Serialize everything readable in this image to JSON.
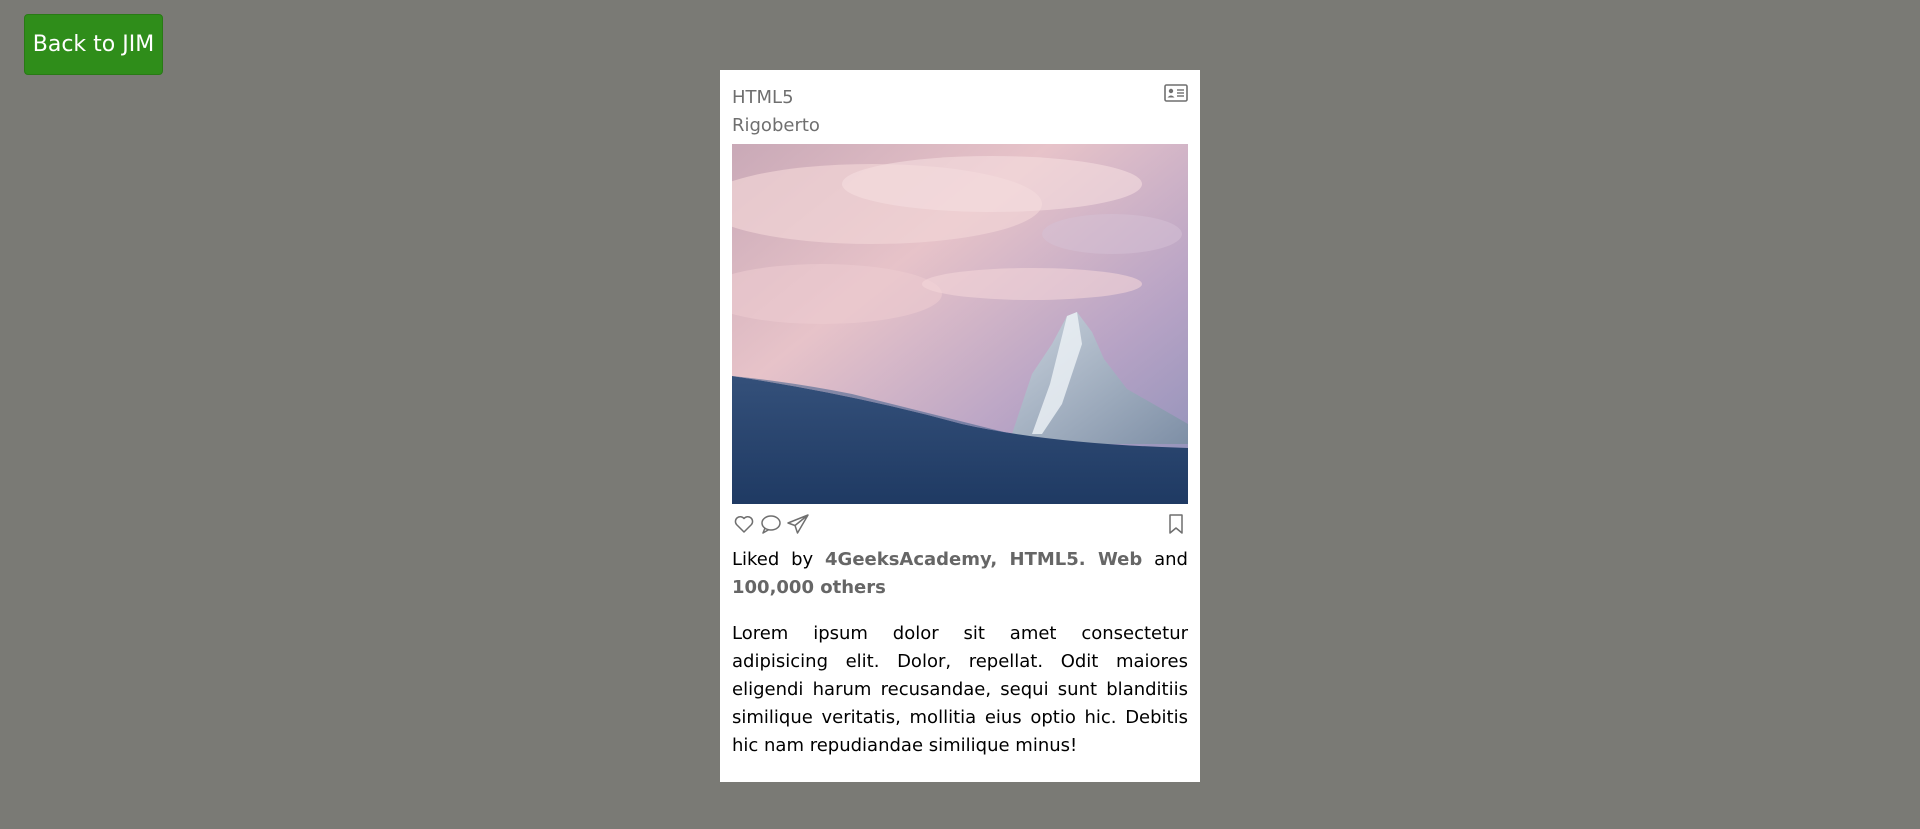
{
  "back_button": {
    "label": "Back to JIM"
  },
  "card": {
    "title": "HTML5",
    "user": "Rigoberto",
    "header_icon": "id-card-icon",
    "photo": {
      "subject": "snowy-mountain-peak-at-dusk"
    },
    "actions": {
      "like_icon": "heart-icon",
      "comment_icon": "speech-bubble-icon",
      "share_icon": "paper-plane-icon",
      "save_icon": "bookmark-icon"
    },
    "likes": {
      "prefix": "Liked by",
      "names": "4GeeksAcademy, HTML5. Web",
      "conjunction": "and",
      "others": "100,000 others"
    },
    "description": "Lorem ipsum dolor sit amet consectetur adipisicing elit. Dolor, repellat. Odit maiores eligendi harum recusandae, sequi sunt blanditiis similique veritatis, mollitia eius optio hic. Debitis hic nam repudiandae similique minus!"
  },
  "colors": {
    "page_background": "#7a7a75",
    "button_green": "#2f8d1a",
    "card_background": "#ffffff",
    "text_gray": "#6f6f6f"
  }
}
